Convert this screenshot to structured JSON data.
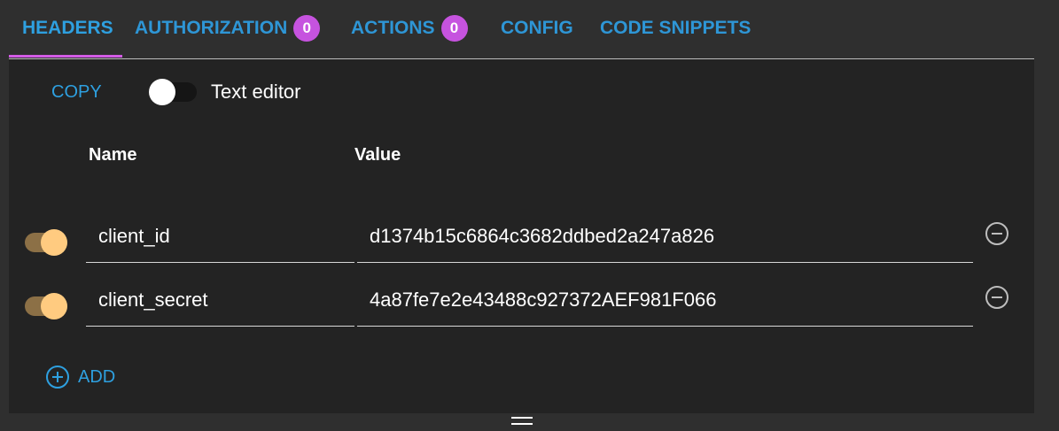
{
  "tabs": [
    {
      "label": "HEADERS",
      "badge": null,
      "active": true
    },
    {
      "label": "AUTHORIZATION",
      "badge": "0"
    },
    {
      "label": "ACTIONS",
      "badge": "0"
    },
    {
      "label": "CONFIG",
      "badge": null
    },
    {
      "label": "CODE SNIPPETS",
      "badge": null
    }
  ],
  "toolbar": {
    "copy_label": "COPY",
    "text_editor_label": "Text editor",
    "text_editor_enabled": false
  },
  "table": {
    "columns": [
      "Name",
      "Value"
    ],
    "rows": [
      {
        "enabled": true,
        "name": "client_id",
        "value": "d1374b15c6864c3682ddbed2a247a826"
      },
      {
        "enabled": true,
        "name": "client_secret",
        "value": "4a87fe7e2e43488c927372AEF981F066"
      }
    ]
  },
  "add_label": "ADD",
  "colors": {
    "accent": "#2ea0e0",
    "badge": "#c653df",
    "toggle_on_thumb": "#ffcb80",
    "panel": "#232323"
  }
}
